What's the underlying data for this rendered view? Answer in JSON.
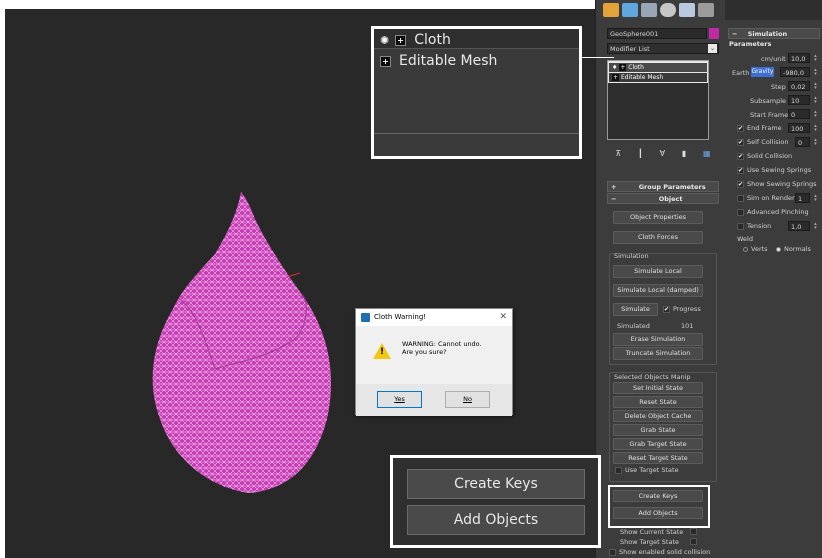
{
  "viewport": {
    "label": "Perspective viewport"
  },
  "top_icons": [
    "create-tab-icon",
    "modify-tab-icon",
    "hierarchy-tab-icon",
    "motion-tab-icon",
    "display-tab-icon",
    "utilities-tab-icon"
  ],
  "modify_panel": {
    "object_name": "GeoSphere001",
    "object_color": "#c02aa6",
    "modifier_list_label": "Modifier List",
    "stack": [
      "Cloth",
      "Editable Mesh"
    ],
    "group_parameters_label": "Group Parameters",
    "object_rollout_label": "Object",
    "object_properties": "Object Properties",
    "cloth_forces": "Cloth Forces",
    "simulation_group": "Simulation",
    "simulate_local": "Simulate Local",
    "simulate_local_damped": "Simulate Local (damped)",
    "simulate": "Simulate",
    "progress": "Progress",
    "simulated_label": "Simulated",
    "simulated_value": "101",
    "erase_simulation": "Erase Simulation",
    "truncate_simulation": "Truncate Simulation",
    "selected_objects_group": "Selected Objects Manip",
    "set_initial_state": "Set Initial State",
    "reset_state": "Reset State",
    "delete_object_cache": "Delete Object Cache",
    "grab_state": "Grab State",
    "grab_target_state": "Grab Target State",
    "reset_target_state": "Reset Target State",
    "use_target_state": "Use Target State",
    "create_keys": "Create Keys",
    "add_objects": "Add Objects",
    "show_current_state": "Show Current State",
    "show_target_state": "Show Target State",
    "show_enabled_solid_collision": "Show enabled solid collision"
  },
  "simulation_parameters": {
    "title": "Simulation Parameters",
    "cm_unit_label": "cm/unit",
    "cm_unit_value": "10,0",
    "earth_label": "Earth",
    "gravity_label": "Gravity",
    "gravity_value": "-980,0",
    "step_label": "Step",
    "step_value": "0,02",
    "subsample_label": "Subsample",
    "subsample_value": "10",
    "start_frame_label": "Start Frame",
    "start_frame_value": "0",
    "end_frame_label": "End Frame",
    "end_frame_value": "100",
    "self_collision_label": "Self Collision",
    "self_collision_value": "0",
    "solid_collision": "Solid Collision",
    "use_sewing_springs": "Use Sewing Springs",
    "show_sewing_springs": "Show Sewing Springs",
    "sim_on_render_label": "Sim on Render",
    "sim_on_render_value": "1",
    "advanced_pinching": "Advanced Pinching",
    "tension_label": "Tension",
    "tension_value": "1,0",
    "weld_label": "Weld",
    "verts": "Verts",
    "normals": "Normals"
  },
  "callout_stack": [
    "Cloth",
    "Editable Mesh"
  ],
  "callout_buttons": {
    "create_keys": "Create Keys",
    "add_objects": "Add Objects"
  },
  "dialog": {
    "title": "Cloth Warning!",
    "message_line1": "WARNING: Cannot undo.",
    "message_line2": "Are you sure?",
    "yes": "Yes",
    "no": "No"
  },
  "colors": {
    "cloth_mesh": "#c93cb8",
    "highlight_blue": "#3c6fd1"
  }
}
